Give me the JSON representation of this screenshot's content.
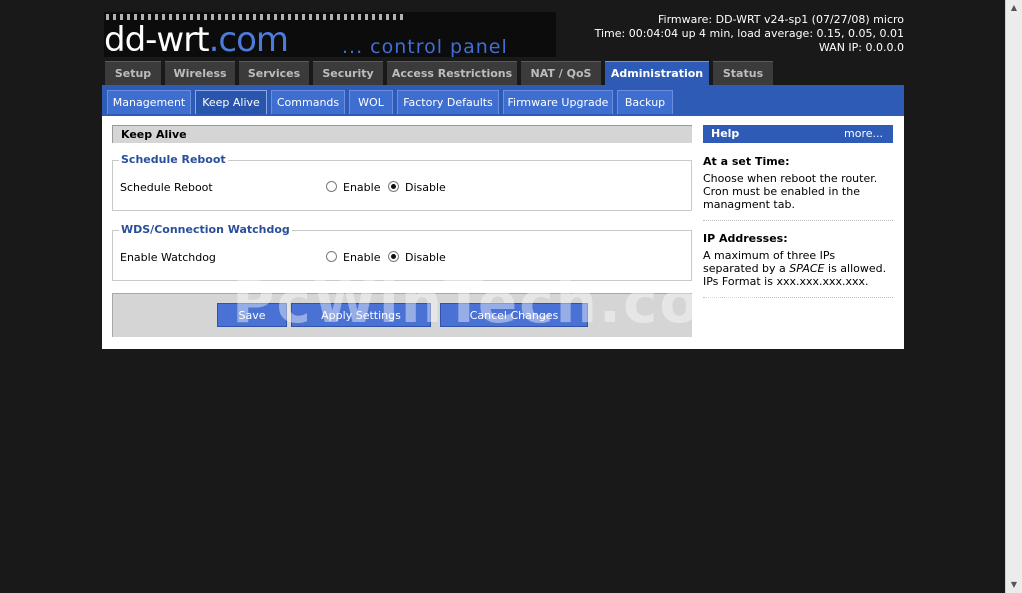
{
  "header": {
    "brand_main": "dd-wrt",
    "brand_dot": ".com",
    "brand_sub": "... control panel",
    "firmware": "Firmware: DD-WRT v24-sp1 (07/27/08) micro",
    "time": "Time: 00:04:04 up 4 min, load average: 0.15, 0.05, 0.01",
    "wan_ip": "WAN IP: 0.0.0.0"
  },
  "main_tabs": [
    "Setup",
    "Wireless",
    "Services",
    "Security",
    "Access Restrictions",
    "NAT / QoS",
    "Administration",
    "Status"
  ],
  "active_main_tab": "Administration",
  "sub_tabs": [
    "Management",
    "Keep Alive",
    "Commands",
    "WOL",
    "Factory Defaults",
    "Firmware Upgrade",
    "Backup"
  ],
  "active_sub_tab": "Keep Alive",
  "page_title": "Keep Alive",
  "sections": [
    {
      "legend": "Schedule Reboot",
      "row_label": "Schedule Reboot",
      "options": [
        "Enable",
        "Disable"
      ],
      "selected": "Disable"
    },
    {
      "legend": "WDS/Connection Watchdog",
      "row_label": "Enable Watchdog",
      "options": [
        "Enable",
        "Disable"
      ],
      "selected": "Disable"
    }
  ],
  "buttons": {
    "save": "Save",
    "apply": "Apply Settings",
    "cancel": "Cancel Changes"
  },
  "help": {
    "title": "Help",
    "more": "more...",
    "items": [
      {
        "title": "At a set Time:",
        "text": "Choose when reboot the router. Cron must be enabled in the managment tab."
      },
      {
        "title": "IP Addresses:",
        "text_pre": "A maximum of three IPs separated by a ",
        "text_em": "SPACE",
        "text_post": " is allowed.",
        "text2": "IPs Format is xxx.xxx.xxx.xxx."
      }
    ]
  },
  "watermark": "PcWinTech.com",
  "colors": {
    "accent": "#2d5bb6",
    "button": "#4a72d4",
    "background": "#191919"
  }
}
